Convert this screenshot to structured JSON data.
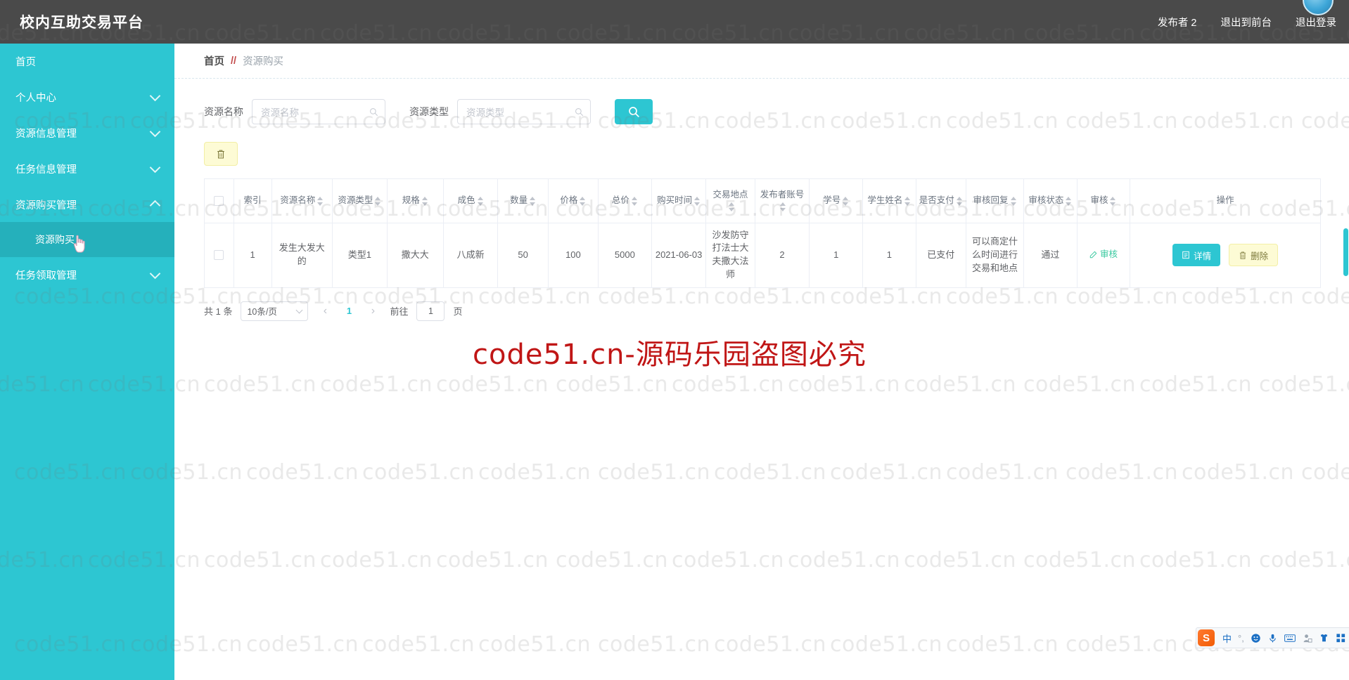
{
  "header": {
    "title": "校内互助交易平台",
    "links": [
      {
        "label": "发布者 2",
        "name": "publisher-account"
      },
      {
        "label": "退出到前台",
        "name": "exit-to-frontend"
      },
      {
        "label": "退出登录",
        "name": "logout"
      }
    ]
  },
  "sidebar": {
    "items": [
      {
        "label": "首页",
        "expandable": false,
        "active": false
      },
      {
        "label": "个人中心",
        "expandable": true,
        "expanded": false
      },
      {
        "label": "资源信息管理",
        "expandable": true,
        "expanded": false
      },
      {
        "label": "任务信息管理",
        "expandable": true,
        "expanded": false
      },
      {
        "label": "资源购买管理",
        "expandable": true,
        "expanded": true
      },
      {
        "label": "任务领取管理",
        "expandable": true,
        "expanded": false
      }
    ],
    "submenu": {
      "label": "资源购买",
      "active": true
    }
  },
  "breadcrumb": {
    "home": "首页",
    "separator": "//",
    "current": "资源购买"
  },
  "search": {
    "name_label": "资源名称",
    "name_placeholder": "资源名称",
    "name_value": "",
    "type_label": "资源类型",
    "type_placeholder": "资源类型",
    "type_value": "",
    "search_icon": "search-icon"
  },
  "toolbar": {
    "delete_icon": "trash-icon"
  },
  "table": {
    "columns": [
      {
        "label": "",
        "sortable": false,
        "key": "checkbox"
      },
      {
        "label": "索引",
        "sortable": false,
        "key": "index"
      },
      {
        "label": "资源名称",
        "sortable": true,
        "key": "resource_name"
      },
      {
        "label": "资源类型",
        "sortable": true,
        "key": "resource_type"
      },
      {
        "label": "规格",
        "sortable": true,
        "key": "spec"
      },
      {
        "label": "成色",
        "sortable": true,
        "key": "condition"
      },
      {
        "label": "数量",
        "sortable": true,
        "key": "quantity"
      },
      {
        "label": "价格",
        "sortable": true,
        "key": "price"
      },
      {
        "label": "总价",
        "sortable": true,
        "key": "total_price"
      },
      {
        "label": "购买时间",
        "sortable": true,
        "key": "purchase_time"
      },
      {
        "label": "交易地点",
        "sortable": true,
        "key": "trade_place"
      },
      {
        "label": "发布者账号",
        "sortable": true,
        "key": "publisher_account"
      },
      {
        "label": "学号",
        "sortable": true,
        "key": "student_no"
      },
      {
        "label": "学生姓名",
        "sortable": true,
        "key": "student_name"
      },
      {
        "label": "是否支付",
        "sortable": true,
        "key": "paid"
      },
      {
        "label": "审核回复",
        "sortable": true,
        "key": "audit_reply"
      },
      {
        "label": "审核状态",
        "sortable": true,
        "key": "audit_status"
      },
      {
        "label": "审核",
        "sortable": true,
        "key": "audit"
      },
      {
        "label": "操作",
        "sortable": false,
        "key": "operation"
      }
    ],
    "rows": [
      {
        "index": "1",
        "resource_name": "发生大发大的",
        "resource_type": "类型1",
        "spec": "撒大大",
        "condition": "八成新",
        "quantity": "50",
        "price": "100",
        "total_price": "5000",
        "purchase_time": "2021-06-03",
        "trade_place": "沙发防守打法士大夫撒大法师",
        "publisher_account": "2",
        "student_no": "1",
        "student_name": "1",
        "paid": "已支付",
        "audit_reply": "可以商定什么时间进行交易和地点",
        "audit_status": "通过",
        "audit_link": "审核",
        "detail_label": "详情",
        "delete_label": "删除"
      }
    ]
  },
  "pagination": {
    "total_text": "共 1 条",
    "page_size": "10条/页",
    "current_page": "1",
    "jump_label": "前往",
    "jump_value": "1",
    "jump_unit": "页"
  },
  "watermark": {
    "tile_text": "code51.cn",
    "banner_text": "code51.cn-源码乐园盗图必究",
    "banner_color": "#c01616"
  },
  "ime": {
    "logo": "S",
    "items": [
      "中",
      "°,",
      "emoji-icon",
      "mic-icon",
      "keyboard-icon",
      "user-icon",
      "skin-icon",
      "apps-icon"
    ]
  },
  "colors": {
    "brand": "#2dc6d2",
    "header_bg": "#4a4a4a",
    "submenu_active": "#25b0bb",
    "audit_green": "#3ac9a0"
  }
}
